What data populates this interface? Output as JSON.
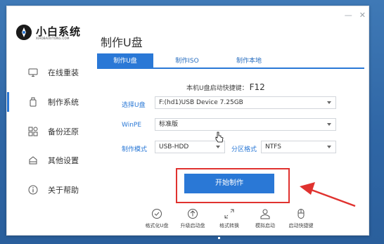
{
  "app": {
    "logo_text": "小白系统",
    "logo_subtitle": "XIAOBAIXITONG.COM",
    "page_title": "制作U盘"
  },
  "sidebar": {
    "items": [
      {
        "label": "在线重装",
        "icon": "monitor-icon"
      },
      {
        "label": "制作系统",
        "icon": "usb-icon"
      },
      {
        "label": "备份还原",
        "icon": "backup-icon"
      },
      {
        "label": "其他设置",
        "icon": "settings-icon"
      },
      {
        "label": "关于帮助",
        "icon": "info-icon"
      }
    ],
    "active_index": 1
  },
  "tabs": [
    {
      "label": "制作U盘"
    },
    {
      "label": "制作ISO"
    },
    {
      "label": "制作本地"
    }
  ],
  "form": {
    "hotkey_label": "本机U盘启动快捷键：",
    "hotkey_value": "F12",
    "usb_label": "选择U盘",
    "usb_value": "F:(hd1)USB Device 7.25GB",
    "winpe_label": "WinPE",
    "winpe_value": "标准版",
    "mode_label": "制作模式",
    "mode_value": "USB-HDD",
    "partition_label": "分区格式",
    "partition_value": "NTFS"
  },
  "start_button": "开始制作",
  "tools": [
    {
      "label": "格式化U盘",
      "icon": "format-check-icon"
    },
    {
      "label": "升级启动盘",
      "icon": "upgrade-arrow-icon"
    },
    {
      "label": "格式转换",
      "icon": "convert-icon"
    },
    {
      "label": "模拟启动",
      "icon": "simulate-user-icon"
    },
    {
      "label": "启动快捷键",
      "icon": "mouse-icon"
    }
  ],
  "colors": {
    "accent": "#2a78d6",
    "highlight": "#e0322f"
  }
}
